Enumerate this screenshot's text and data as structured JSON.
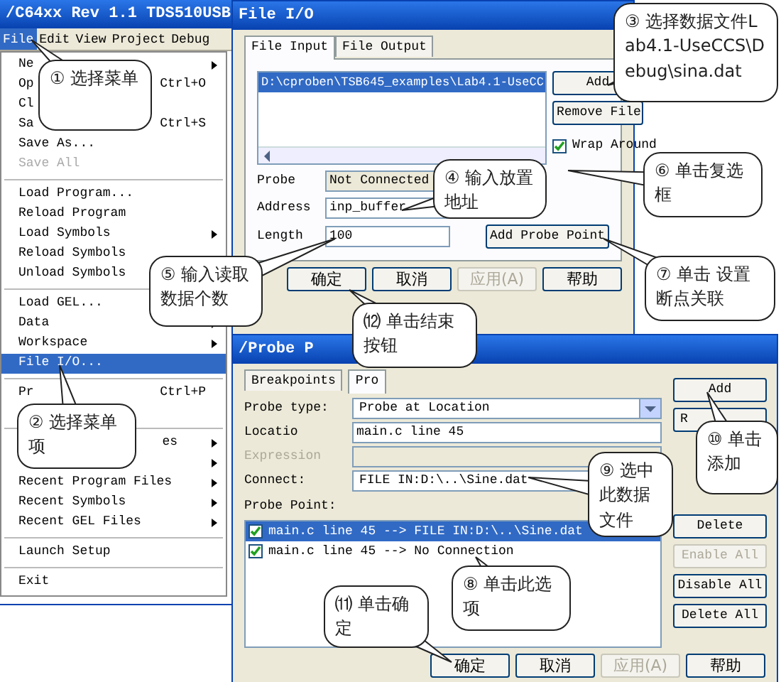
{
  "main_window": {
    "title": "/C64xx Rev 1.1 TDS510USB",
    "menu_bar": [
      {
        "label": "File",
        "selected": true
      },
      {
        "label": "Edit",
        "selected": false
      },
      {
        "label": "View",
        "selected": false
      },
      {
        "label": "Project",
        "selected": false
      },
      {
        "label": "Debug",
        "selected": false
      }
    ]
  },
  "file_menu": [
    {
      "kind": "item",
      "label": "Ne",
      "submenu": true,
      "disabled": false,
      "selected": false
    },
    {
      "kind": "item",
      "label": "Op",
      "shortcut": "Ctrl+O",
      "submenu": false,
      "disabled": false,
      "selected": false
    },
    {
      "kind": "item",
      "label": "Cl",
      "submenu": false,
      "disabled": false,
      "selected": false
    },
    {
      "kind": "item",
      "label": "Sa",
      "shortcut": "Ctrl+S",
      "submenu": false,
      "disabled": false,
      "selected": false
    },
    {
      "kind": "item",
      "label": "Save As...",
      "submenu": false,
      "disabled": false,
      "selected": false
    },
    {
      "kind": "item",
      "label": "Save All",
      "submenu": false,
      "disabled": true,
      "selected": false
    },
    {
      "kind": "separator"
    },
    {
      "kind": "item",
      "label": "Load Program...",
      "submenu": false,
      "disabled": false,
      "selected": false
    },
    {
      "kind": "item",
      "label": "Reload Program",
      "submenu": false,
      "disabled": false,
      "selected": false
    },
    {
      "kind": "item",
      "label": "Load Symbols",
      "submenu": true,
      "disabled": false,
      "selected": false
    },
    {
      "kind": "item",
      "label": "Reload Symbols",
      "submenu": false,
      "disabled": false,
      "selected": false
    },
    {
      "kind": "item",
      "label": "Unload Symbols",
      "submenu": false,
      "disabled": false,
      "selected": false
    },
    {
      "kind": "separator"
    },
    {
      "kind": "item",
      "label": "Load GEL...",
      "submenu": false,
      "disabled": false,
      "selected": false
    },
    {
      "kind": "item",
      "label": "Data",
      "submenu": true,
      "disabled": false,
      "selected": false
    },
    {
      "kind": "item",
      "label": "Workspace",
      "submenu": true,
      "disabled": false,
      "selected": false
    },
    {
      "kind": "item",
      "label": "File I/O...",
      "submenu": false,
      "disabled": false,
      "selected": true
    },
    {
      "kind": "separator"
    },
    {
      "kind": "item",
      "label": "Pr",
      "shortcut": "Ctrl+P",
      "submenu": false,
      "disabled": false,
      "selected": false
    },
    {
      "kind": "covered",
      "submenu": false
    },
    {
      "kind": "separator"
    },
    {
      "kind": "covered",
      "label": "es",
      "submenu": true
    },
    {
      "kind": "covered",
      "submenu": true
    },
    {
      "kind": "item",
      "label": "Recent Program Files",
      "submenu": true,
      "disabled": false,
      "selected": false
    },
    {
      "kind": "item",
      "label": "Recent Symbols",
      "submenu": true,
      "disabled": false,
      "selected": false
    },
    {
      "kind": "item",
      "label": "Recent GEL Files",
      "submenu": true,
      "disabled": false,
      "selected": false
    },
    {
      "kind": "separator"
    },
    {
      "kind": "item",
      "label": "Launch Setup",
      "submenu": false,
      "disabled": false,
      "selected": false
    },
    {
      "kind": "separator"
    },
    {
      "kind": "item",
      "label": "Exit",
      "submenu": false,
      "disabled": false,
      "selected": false
    }
  ],
  "file_io_dialog": {
    "title": "File I/O",
    "tabs": [
      {
        "label": "File Input",
        "selected": true
      },
      {
        "label": "File Output",
        "selected": false
      }
    ],
    "files": [
      {
        "path": "D:\\cproben\\TSB645_examples\\Lab4.1-UseCC",
        "selected": true
      }
    ],
    "file_buttons": [
      "Add",
      "Remove File"
    ],
    "wrap_around": {
      "label": "Wrap Around",
      "checked": true
    },
    "fields": [
      {
        "label": "Probe",
        "value": "Not Connected",
        "readonly": true
      },
      {
        "label": "Address",
        "value": "inp_buffer",
        "readonly": false
      },
      {
        "label": "Length",
        "value": "100",
        "readonly": false
      }
    ],
    "add_probe_point": "Add Probe Point",
    "footer_buttons": [
      {
        "label": "确定",
        "disabled": false
      },
      {
        "label": "取消",
        "disabled": false
      },
      {
        "label": "应用(A)",
        "disabled": true
      },
      {
        "label": "帮助",
        "disabled": false
      }
    ]
  },
  "probe_points_dialog": {
    "title": "/Probe P",
    "tabs": [
      {
        "label": "Breakpoints",
        "selected": false
      },
      {
        "label": "Pro",
        "selected": true
      }
    ],
    "fields": [
      {
        "label": "Probe type:",
        "kind": "combo",
        "value": "Probe at Location",
        "disabled": false
      },
      {
        "label": "Locatio",
        "kind": "text",
        "value": "main.c line 45",
        "disabled": false
      },
      {
        "label": "Expression",
        "kind": "text",
        "disabled": true
      },
      {
        "label": "Connect:",
        "kind": "combo",
        "value": "FILE IN:D:\\..\\Sine.dat",
        "disabled": false
      }
    ],
    "list_label": "Probe Point:",
    "probe_points": [
      {
        "text": "main.c line 45 --> FILE IN:D:\\..\\Sine.dat",
        "checked": true,
        "selected": true
      },
      {
        "text": "main.c line 45 --> No Connection",
        "checked": true,
        "selected": false
      }
    ],
    "top_buttons": [
      {
        "label": "Add",
        "disabled": false
      },
      {
        "label": "R",
        "disabled": false
      }
    ],
    "side_buttons": [
      {
        "label": "Delete",
        "disabled": false
      },
      {
        "label": "Enable All",
        "disabled": true
      },
      {
        "label": "Disable All",
        "disabled": false
      },
      {
        "label": "Delete All",
        "disabled": false
      }
    ],
    "footer_buttons": [
      {
        "label": "确定",
        "disabled": false
      },
      {
        "label": "取消",
        "disabled": false
      },
      {
        "label": "应用(A)",
        "disabled": true
      },
      {
        "label": "帮助",
        "disabled": false
      }
    ]
  },
  "annotations": [
    {
      "text": "① 选择菜单"
    },
    {
      "text": "③ 选择数据文件Lab4.1-UseCCS\\Debug\\sina.dat"
    },
    {
      "text": "④ 输入放置地址"
    },
    {
      "text": "⑥ 单击复选框"
    },
    {
      "text": "⑤ 输入读取数据个数"
    },
    {
      "text": "⑦ 单击 设置断点关联"
    },
    {
      "text": "⑿ 单击结束按钮"
    },
    {
      "text": "② 选择菜单项"
    },
    {
      "text": "⑨ 选中此数据文件"
    },
    {
      "text": "⑩ 单击添加"
    },
    {
      "text": "⑾ 单击确定"
    },
    {
      "text": "⑧ 单击此选项"
    }
  ]
}
